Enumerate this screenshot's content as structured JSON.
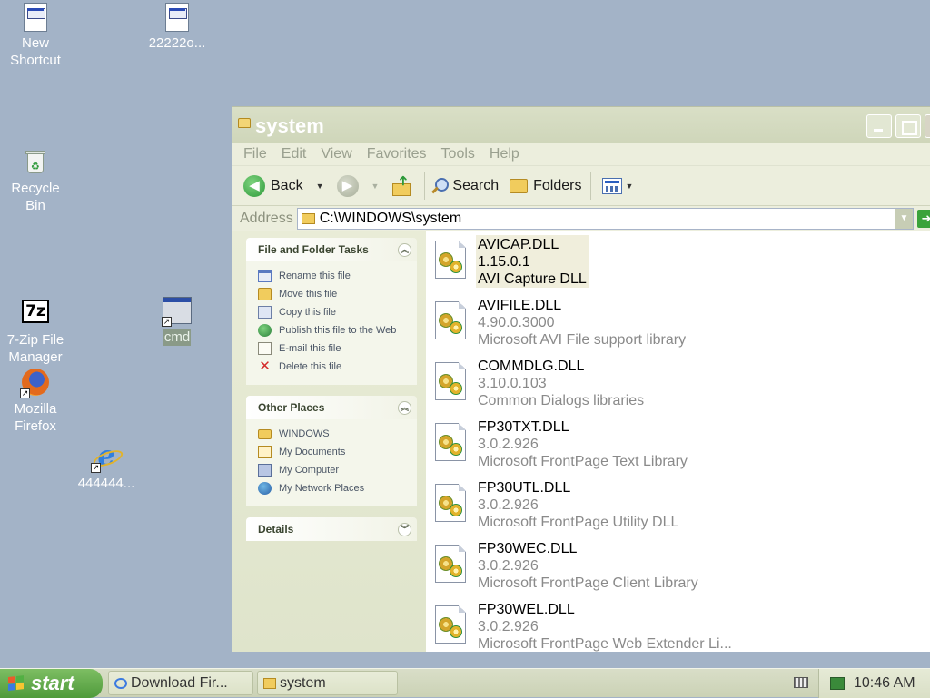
{
  "desktop": {
    "icons": [
      {
        "label": "New\nShortcut",
        "kind": "document-shortcut-icon"
      },
      {
        "label": "22222o...",
        "kind": "document-shortcut-icon"
      },
      {
        "label": "Recycle\nBin",
        "kind": "recycle-bin-icon"
      },
      {
        "label": "7-Zip File\nManager",
        "kind": "seven-zip-icon"
      },
      {
        "label": "cmd",
        "kind": "cmd-window-icon"
      },
      {
        "label": "Mozilla\nFirefox",
        "kind": "firefox-icon"
      },
      {
        "label": "444444...",
        "kind": "internet-explorer-icon"
      }
    ]
  },
  "window": {
    "title": "system",
    "menu": [
      "File",
      "Edit",
      "View",
      "Favorites",
      "Tools",
      "Help"
    ],
    "toolbar": {
      "back": "Back",
      "search": "Search",
      "folders": "Folders"
    },
    "address": {
      "label": "Address",
      "value": "C:\\WINDOWS\\system"
    },
    "taskpane": {
      "file_tasks": {
        "title": "File and Folder Tasks",
        "items": [
          "Rename this file",
          "Move this file",
          "Copy this file",
          "Publish this file to the Web",
          "E-mail this file",
          "Delete this file"
        ]
      },
      "other_places": {
        "title": "Other Places",
        "items": [
          "WINDOWS",
          "My Documents",
          "My Computer",
          "My Network Places"
        ]
      },
      "details": {
        "title": "Details"
      }
    },
    "files": [
      {
        "name": "AVICAP.DLL",
        "version": "1.15.0.1",
        "desc": "AVI Capture DLL",
        "selected": true
      },
      {
        "name": "AVIFILE.DLL",
        "version": "4.90.0.3000",
        "desc": "Microsoft AVI File support library"
      },
      {
        "name": "COMMDLG.DLL",
        "version": "3.10.0.103",
        "desc": "Common Dialogs libraries"
      },
      {
        "name": "FP30TXT.DLL",
        "version": "3.0.2.926",
        "desc": "Microsoft FrontPage Text Library"
      },
      {
        "name": "FP30UTL.DLL",
        "version": "3.0.2.926",
        "desc": "Microsoft FrontPage Utility DLL"
      },
      {
        "name": "FP30WEC.DLL",
        "version": "3.0.2.926",
        "desc": "Microsoft FrontPage Client Library"
      },
      {
        "name": "FP30WEL.DLL",
        "version": "3.0.2.926",
        "desc": "Microsoft FrontPage Web Extender Li..."
      }
    ]
  },
  "taskbar": {
    "start": "start",
    "tasks": [
      "Download Fir...",
      "system"
    ],
    "clock": "10:46 AM"
  },
  "colors": {
    "desktop": "#a3b3c7",
    "start_green": "#4f9a3b",
    "selection": "#f0eedc"
  }
}
